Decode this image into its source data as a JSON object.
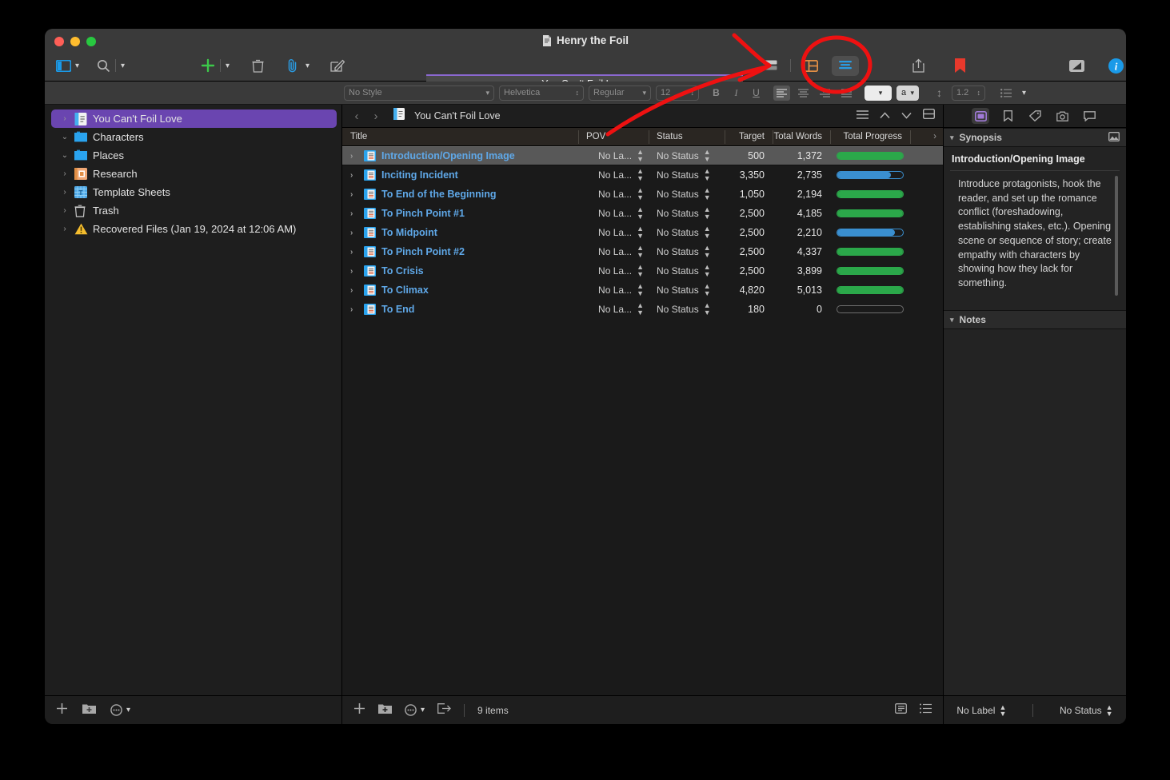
{
  "window": {
    "title": "Henry the Foil",
    "title_icon": "scrivener-doc-icon",
    "traffic_lights": [
      "close",
      "minimize",
      "zoom"
    ]
  },
  "toolbar": {
    "left": [
      {
        "name": "view-toggle-icon",
        "label": "",
        "glyph": "panel"
      },
      {
        "name": "search-icon",
        "label": "",
        "glyph": "magnifier"
      }
    ],
    "center": [
      {
        "name": "add-icon",
        "label": "+"
      },
      {
        "name": "trash-icon",
        "label": ""
      },
      {
        "name": "attachment-icon",
        "label": ""
      },
      {
        "name": "compose-icon",
        "label": ""
      }
    ],
    "doc_title": "You Can't Foil Love",
    "view_modes": [
      {
        "name": "corkboard",
        "active": false
      },
      {
        "name": "outline",
        "active": false
      },
      {
        "name": "list",
        "active": true
      }
    ],
    "right": [
      {
        "name": "share-icon"
      },
      {
        "name": "bookmark-icon"
      },
      {
        "name": "composition-mode-icon"
      },
      {
        "name": "inspector-info-icon"
      }
    ]
  },
  "format_bar": {
    "style": "No Style",
    "font": "Helvetica",
    "weight": "Regular",
    "size": "12",
    "bold": "B",
    "italic": "I",
    "underline": "U",
    "line_spacing": "1.2",
    "text_color_swatch": "#ffffff",
    "highlight_label": "a"
  },
  "sidebar": {
    "items": [
      {
        "label": "You Can't Foil Love",
        "icon": "manuscript-icon",
        "disclosure": "collapsed",
        "selected": true
      },
      {
        "label": "Characters",
        "icon": "folder-icon",
        "disclosure": "expanded",
        "selected": false
      },
      {
        "label": "Places",
        "icon": "folder-icon",
        "disclosure": "expanded",
        "selected": false
      },
      {
        "label": "Research",
        "icon": "research-icon",
        "disclosure": "collapsed",
        "selected": false
      },
      {
        "label": "Template Sheets",
        "icon": "template-icon",
        "disclosure": "collapsed",
        "selected": false
      },
      {
        "label": "Trash",
        "icon": "trash-icon",
        "disclosure": "collapsed",
        "selected": false
      },
      {
        "label": "Recovered Files (Jan 19, 2024 at 12:06 AM)",
        "icon": "warning-icon",
        "disclosure": "collapsed",
        "selected": false
      }
    ],
    "footer": [
      {
        "name": "add-document-icon",
        "label": "+"
      },
      {
        "name": "add-folder-icon",
        "label": ""
      },
      {
        "name": "actions-menu-icon",
        "label": ""
      }
    ]
  },
  "main": {
    "breadcrumb": {
      "back": "‹",
      "forward": "›",
      "icon": "manuscript-icon",
      "title": "You Can't Foil Love"
    },
    "breadcrumb_right": [
      {
        "name": "outline-options-icon"
      },
      {
        "name": "previous-document-icon"
      },
      {
        "name": "next-document-icon"
      },
      {
        "name": "split-editor-icon"
      }
    ],
    "columns": [
      "Title",
      "POV",
      "Status",
      "Target",
      "Total Words",
      "Total Progress"
    ],
    "rows": [
      {
        "title": "Introduction/Opening Image",
        "pov": "No La...",
        "status": "No Status",
        "target": "500",
        "total_words": "1,372",
        "progress_pct": 100,
        "progress_color": "#2ba84a",
        "selected": true
      },
      {
        "title": "Inciting Incident",
        "pov": "No La...",
        "status": "No Status",
        "target": "3,350",
        "total_words": "2,735",
        "progress_pct": 82,
        "progress_color": "#3a8fd0",
        "selected": false
      },
      {
        "title": "To End of the Beginning",
        "pov": "No La...",
        "status": "No Status",
        "target": "1,050",
        "total_words": "2,194",
        "progress_pct": 100,
        "progress_color": "#2ba84a",
        "selected": false
      },
      {
        "title": "To Pinch Point #1",
        "pov": "No La...",
        "status": "No Status",
        "target": "2,500",
        "total_words": "4,185",
        "progress_pct": 100,
        "progress_color": "#2ba84a",
        "selected": false
      },
      {
        "title": "To Midpoint",
        "pov": "No La...",
        "status": "No Status",
        "target": "2,500",
        "total_words": "2,210",
        "progress_pct": 88,
        "progress_color": "#3a8fd0",
        "selected": false
      },
      {
        "title": "To Pinch Point #2",
        "pov": "No La...",
        "status": "No Status",
        "target": "2,500",
        "total_words": "4,337",
        "progress_pct": 100,
        "progress_color": "#2ba84a",
        "selected": false
      },
      {
        "title": "To Crisis",
        "pov": "No La...",
        "status": "No Status",
        "target": "2,500",
        "total_words": "3,899",
        "progress_pct": 100,
        "progress_color": "#2ba84a",
        "selected": false
      },
      {
        "title": "To Climax",
        "pov": "No La...",
        "status": "No Status",
        "target": "4,820",
        "total_words": "5,013",
        "progress_pct": 100,
        "progress_color": "#2ba84a",
        "selected": false
      },
      {
        "title": "To End",
        "pov": "No La...",
        "status": "No Status",
        "target": "180",
        "total_words": "0",
        "progress_pct": 0,
        "progress_color": "#2ba84a",
        "selected": false
      }
    ],
    "footer": {
      "add_label": "+",
      "item_count": "9 items"
    }
  },
  "inspector": {
    "tabs": [
      {
        "name": "notes-tab",
        "active": true
      },
      {
        "name": "bookmarks-tab",
        "active": false
      },
      {
        "name": "metadata-tab",
        "active": false
      },
      {
        "name": "snapshots-tab",
        "active": false
      },
      {
        "name": "comments-tab",
        "active": false
      }
    ],
    "synopsis": {
      "section_label": "Synopsis",
      "image_toggle": "synopsis-image-icon",
      "title": "Introduction/Opening Image",
      "text": "Introduce protagonists, hook the reader, and set up the romance conflict (foreshadowing, establishing stakes, etc.). Opening scene or sequence of story; create empathy with characters by showing how they lack for something."
    },
    "notes": {
      "section_label": "Notes",
      "text": ""
    },
    "footer": {
      "label": "No Label",
      "status": "No Status"
    }
  },
  "annotation": {
    "color": "#ee1111",
    "shapes": [
      "arrow-pointing-to-corkboard-button",
      "ellipse-around-list-view-button"
    ]
  },
  "colors": {
    "selection_purple": "#6a45b0",
    "accent_blue": "#5fa8e8",
    "progress_green": "#2ba84a",
    "progress_blue": "#3a8fd0",
    "annotation_red": "#ee1111"
  }
}
